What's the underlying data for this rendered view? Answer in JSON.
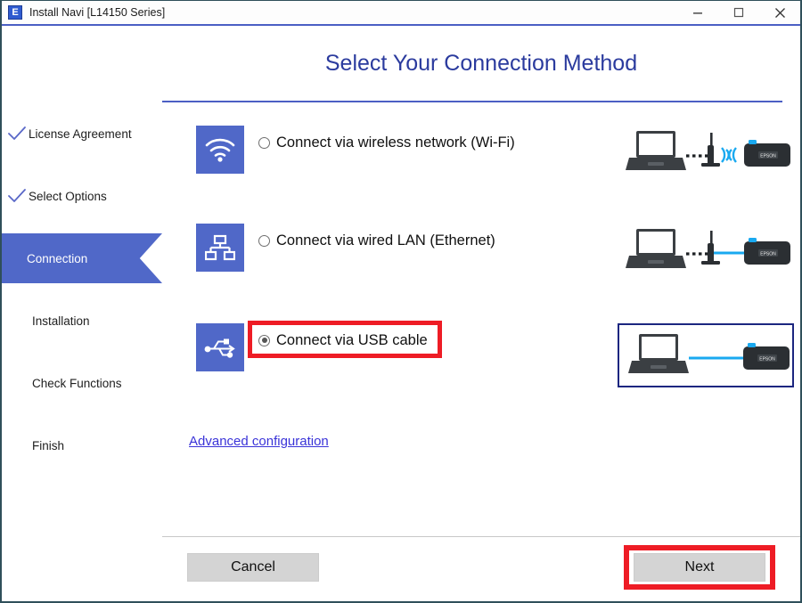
{
  "window": {
    "app_icon": "epson-e-icon",
    "title": "Install Navi [L14150 Series]",
    "icon_letter": "E",
    "controls": {
      "minimize": "minimize-icon",
      "maximize": "maximize-icon",
      "close": "close-icon"
    }
  },
  "header": {
    "title": "Select Your Connection Method",
    "title_color": "#2b3b9e"
  },
  "sidebar": {
    "active_color": "#5068c8",
    "items": [
      {
        "label": "License Agreement",
        "state": "completed",
        "icon": "check-icon"
      },
      {
        "label": "Select Options",
        "state": "completed",
        "icon": "check-icon"
      },
      {
        "label": "Connection",
        "state": "active",
        "icon": ""
      },
      {
        "label": "Installation",
        "state": "pending",
        "icon": ""
      },
      {
        "label": "Check Functions",
        "state": "pending",
        "icon": ""
      },
      {
        "label": "Finish",
        "state": "pending",
        "icon": ""
      }
    ]
  },
  "options": [
    {
      "id": "wifi",
      "label": "Connect via wireless network (Wi-Fi)",
      "selected": false,
      "tile_icon": "wifi-icon",
      "illustration": "laptop-router-wireless-printer",
      "illustration_selected": false,
      "printer_label": "EPSON",
      "highlighted": false
    },
    {
      "id": "ethernet",
      "label": "Connect via wired LAN (Ethernet)",
      "selected": false,
      "tile_icon": "lan-network-icon",
      "illustration": "laptop-router-wired-printer",
      "illustration_selected": false,
      "printer_label": "EPSON",
      "highlighted": false
    },
    {
      "id": "usb",
      "label": "Connect via USB cable",
      "selected": true,
      "tile_icon": "usb-icon",
      "illustration": "laptop-usb-printer",
      "illustration_selected": true,
      "printer_label": "EPSON",
      "highlighted": true
    }
  ],
  "advanced_link": {
    "label": "Advanced configuration",
    "color": "#3a33d8"
  },
  "footer": {
    "cancel_label": "Cancel",
    "next_label": "Next",
    "next_highlighted": true
  },
  "annotation": {
    "color": "#ee1c25"
  }
}
